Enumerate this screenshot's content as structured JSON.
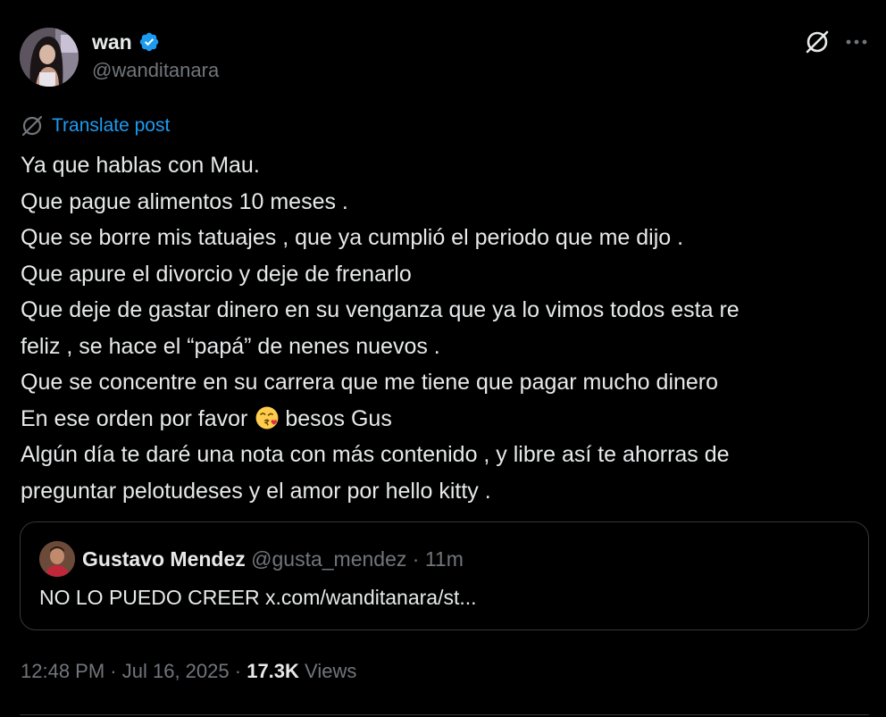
{
  "author": {
    "name": "wan",
    "handle": "@wanditanara",
    "verified": true
  },
  "actions": {
    "grok_icon": "grok-slash-icon",
    "more_icon": "more-dots-icon"
  },
  "translate": {
    "label": "Translate post",
    "icon": "globe-slash-icon"
  },
  "tweet": {
    "lines": [
      "Ya que hablas con Mau.",
      "Que pague alimentos 10 meses .",
      "Que se borre mis tatuajes , que ya cumplió el periodo que me dijo .",
      "Que apure el divorcio y deje de frenarlo",
      "Que deje de gastar dinero en su venganza que ya lo vimos todos esta re",
      "feliz , se hace el “papá” de nenes nuevos .",
      "Que se concentre en su carrera que me tiene que pagar mucho dinero"
    ],
    "line8_before": "En ese orden por favor",
    "line8_after": "besos Gus",
    "emoji": "face-blowing-kiss",
    "lines_end": [
      "Algún día te daré una nota con más contenido , y libre así te ahorras de",
      "preguntar pelotudeses y el amor por hello kitty ."
    ]
  },
  "quote": {
    "name": "Gustavo Mendez",
    "handle": "@gusta_mendez",
    "separator": "·",
    "time": "11m",
    "text": "NO LO PUEDO CREER x.com/wanditanara/st..."
  },
  "meta": {
    "time": "12:48 PM",
    "dot1": "·",
    "date": "Jul 16, 2025",
    "dot2": "·",
    "views_count": "17.3K",
    "views_label": "Views"
  },
  "colors": {
    "background": "#000000",
    "text": "#e7e9ea",
    "secondary": "#71767b",
    "link": "#1d9bf0",
    "verified": "#1d9bf0",
    "border": "#333639"
  }
}
